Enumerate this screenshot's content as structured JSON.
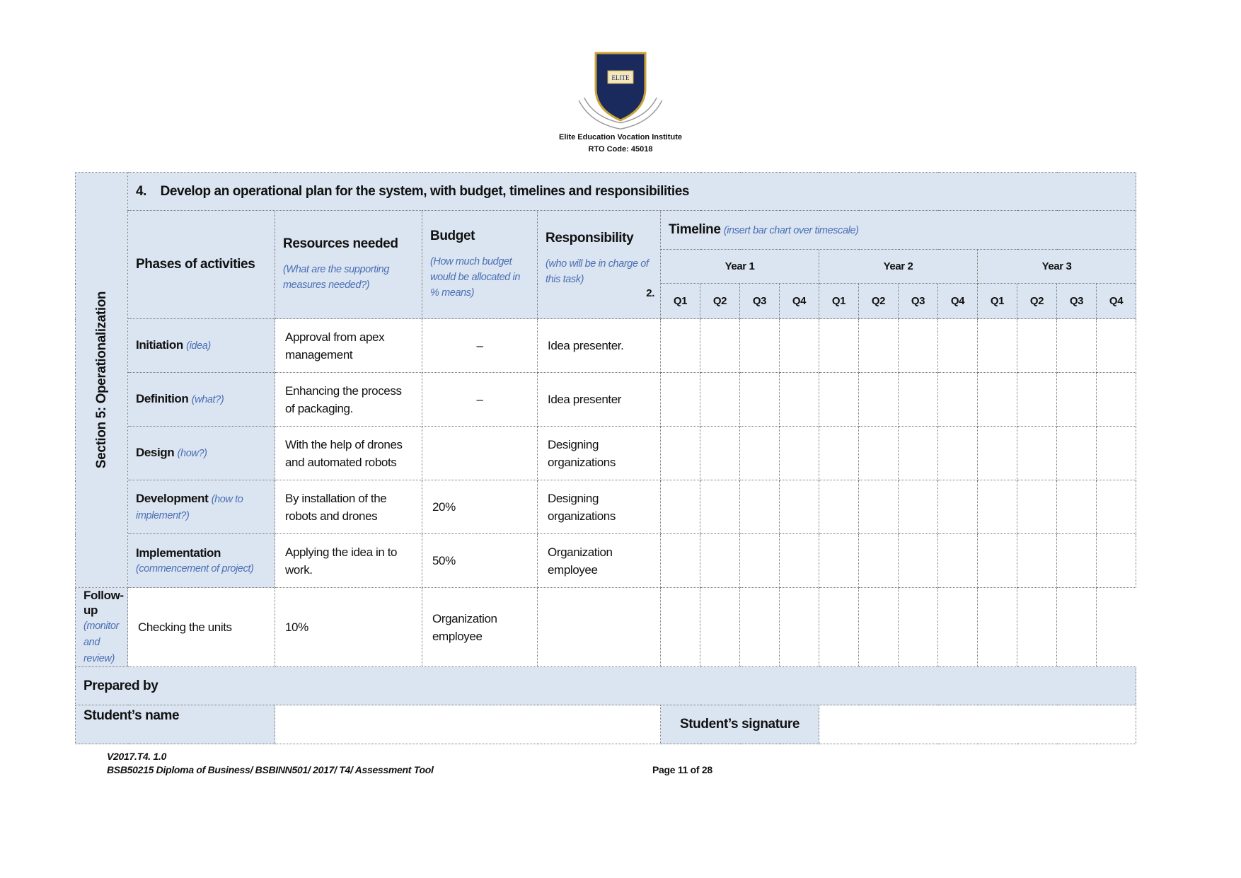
{
  "header": {
    "institute": "Elite Education Vocation Institute",
    "rto_code": "RTO Code: 45018",
    "logo_text": "ELITE SAPIENTIAM"
  },
  "section_label": "Section 5: Operationalization",
  "task": {
    "number": "4.",
    "title": "Develop an operational plan for the system, with budget, timelines and responsibilities"
  },
  "columns": {
    "phases": "Phases of activities",
    "resources": "Resources needed",
    "resources_hint": "(What are the supporting measures needed?)",
    "budget": "Budget",
    "budget_hint": "(How much budget would be allocated in % means)",
    "responsibility": "Responsibility",
    "responsibility_hint": "(who will be in charge of this task)",
    "responsibility_marker": "2.",
    "timeline": "Timeline",
    "timeline_hint": "(insert bar chart over timescale)",
    "years": [
      "Year 1",
      "Year 2",
      "Year 3"
    ],
    "quarters": [
      "Q1",
      "Q2",
      "Q3",
      "Q4"
    ]
  },
  "rows": [
    {
      "phase": "Initiation",
      "hint": "(idea)",
      "resources": "Approval from apex management",
      "budget": "–",
      "responsibility": "Idea presenter."
    },
    {
      "phase": "Definition",
      "hint": "(what?)",
      "resources": "Enhancing the process of packaging.",
      "budget": "–",
      "responsibility": "Idea presenter"
    },
    {
      "phase": "Design",
      "hint": "(how?)",
      "resources": "With the help of drones and automated robots",
      "budget": "",
      "responsibility": "Designing organizations"
    },
    {
      "phase": "Development",
      "hint": "(how to implement?)",
      "resources": "By installation of the robots and drones",
      "budget": "20%",
      "responsibility": "Designing organizations"
    },
    {
      "phase": "Implementation",
      "hint": "(commencement of project)",
      "resources": "Applying the idea in to work.",
      "budget": "50%",
      "responsibility": "Organization employee"
    },
    {
      "phase": "Follow-up",
      "hint": "(monitor and review)",
      "resources": "Checking the units",
      "budget": "10%",
      "responsibility": "Organization employee"
    }
  ],
  "prepared_by": "Prepared by",
  "student_name_label": "Student’s name",
  "student_name": "",
  "student_signature_label": "Student’s signature",
  "student_signature": "",
  "footer": {
    "version": "V2017.T4. 1.0",
    "course": "BSB50215 Diploma of Business/ BSBINN501/ 2017/ T4/ Assessment Tool",
    "page": "Page 11 of 28"
  },
  "colors": {
    "header_bg": "#dbe5f1",
    "hint": "#4a6fb5",
    "crest": "#1b2a5c"
  }
}
